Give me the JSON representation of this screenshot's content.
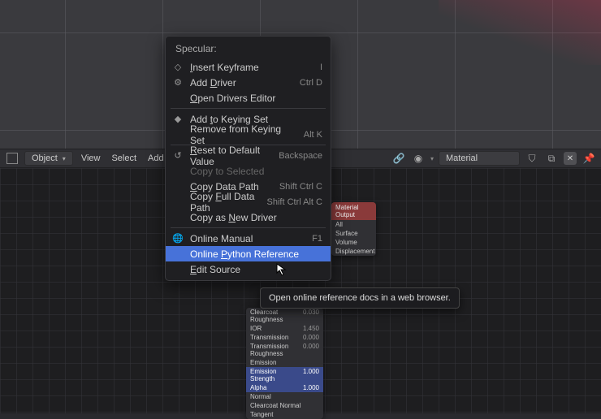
{
  "toolbar": {
    "mode_label": "Object",
    "menus": [
      "View",
      "Select",
      "Add"
    ],
    "material_label": "Material"
  },
  "context_menu": {
    "title": "Specular:",
    "items": [
      {
        "icon": "keyframe-icon",
        "pre": "",
        "u": "I",
        "post": "nsert Keyframe",
        "shortcut": "I"
      },
      {
        "icon": "driver-icon",
        "pre": "Add ",
        "u": "D",
        "post": "river",
        "shortcut": "Ctrl D"
      },
      {
        "icon": "",
        "pre": "",
        "u": "O",
        "post": "pen Drivers Editor",
        "shortcut": ""
      }
    ],
    "items2": [
      {
        "icon": "keyingset-icon",
        "pre": "Add ",
        "u": "t",
        "post": "o Keying Set",
        "shortcut": ""
      },
      {
        "icon": "",
        "pre": "Remove from Keying Set",
        "u": "",
        "post": "",
        "shortcut": "Alt K"
      }
    ],
    "items3": [
      {
        "icon": "reset-icon",
        "pre": "",
        "u": "R",
        "post": "eset to Default Value",
        "shortcut": "Backspace"
      },
      {
        "icon": "",
        "pre": "Copy to Selected",
        "u": "",
        "post": "",
        "shortcut": "",
        "disabled": true
      },
      {
        "icon": "",
        "pre": "",
        "u": "C",
        "post": "opy Data Path",
        "shortcut": "Shift Ctrl C"
      },
      {
        "icon": "",
        "pre": "Copy ",
        "u": "F",
        "post": "ull Data Path",
        "shortcut": "Shift Ctrl Alt C"
      },
      {
        "icon": "",
        "pre": "Copy as ",
        "u": "N",
        "post": "ew Driver",
        "shortcut": ""
      }
    ],
    "items4": [
      {
        "icon": "manual-icon",
        "pre": "Online Manual",
        "u": "",
        "post": "",
        "shortcut": "F1"
      },
      {
        "icon": "",
        "pre": "Online ",
        "u": "P",
        "post": "ython Reference",
        "shortcut": "",
        "hover": true
      },
      {
        "icon": "",
        "pre": "",
        "u": "E",
        "post": "dit Source",
        "shortcut": ""
      }
    ]
  },
  "tooltip": {
    "text": "Open online reference docs in a web browser."
  },
  "nodes": {
    "material_output": {
      "title": "Material Output",
      "rows": [
        "All",
        "Surface",
        "Volume",
        "Displacement"
      ]
    },
    "bsdf": {
      "rows": [
        {
          "k": "Clearcoat Roughness",
          "v": "0.030"
        },
        {
          "k": "IOR",
          "v": "1.450"
        },
        {
          "k": "Transmission",
          "v": "0.000"
        },
        {
          "k": "Transmission Roughness",
          "v": "0.000"
        },
        {
          "k": "Emission",
          "v": ""
        },
        {
          "k": "Emission Strength",
          "v": "1.000",
          "hl": true
        },
        {
          "k": "Alpha",
          "v": "1.000"
        },
        {
          "k": "Normal",
          "v": ""
        },
        {
          "k": "Clearcoat Normal",
          "v": ""
        },
        {
          "k": "Tangent",
          "v": ""
        }
      ]
    }
  }
}
